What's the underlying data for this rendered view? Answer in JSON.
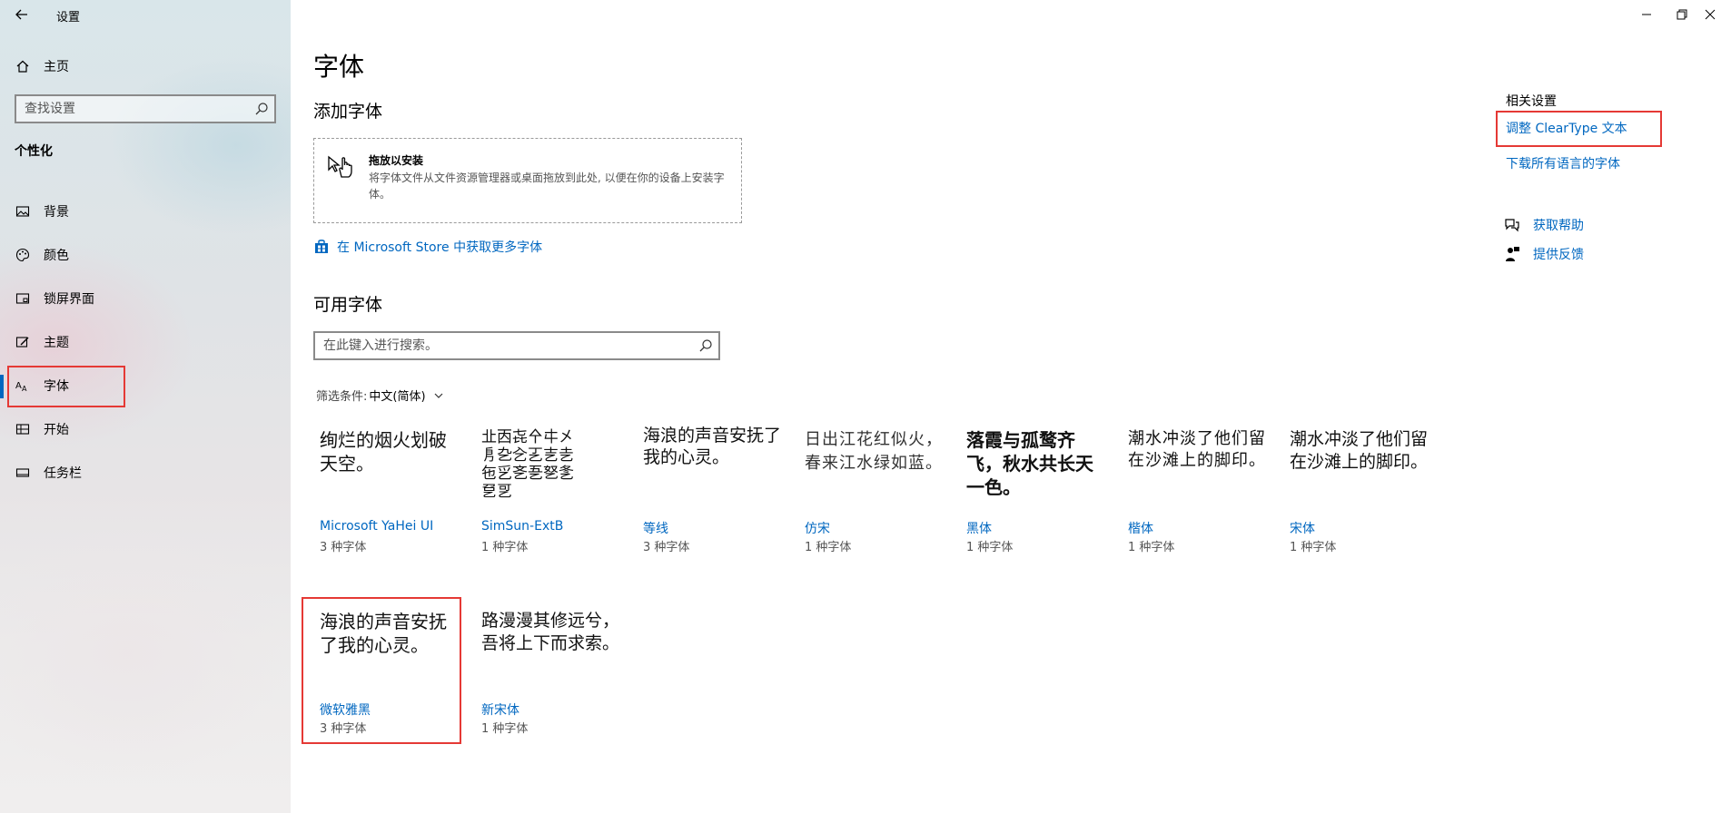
{
  "window": {
    "app_title": "设置",
    "controls": [
      "minimize-icon",
      "restore-icon",
      "close-icon"
    ]
  },
  "sidebar": {
    "home_label": "主页",
    "search_placeholder": "查找设置",
    "section_title": "个性化",
    "items": [
      {
        "label": "背景",
        "icon": "picture-icon"
      },
      {
        "label": "颜色",
        "icon": "palette-icon"
      },
      {
        "label": "锁屏界面",
        "icon": "lock-screen-icon"
      },
      {
        "label": "主题",
        "icon": "theme-brush-icon"
      },
      {
        "label": "字体",
        "icon": "font-aa-icon",
        "active": true
      },
      {
        "label": "开始",
        "icon": "start-tiles-icon"
      },
      {
        "label": "任务栏",
        "icon": "taskbar-icon"
      }
    ]
  },
  "main": {
    "page_title": "字体",
    "add_fonts_heading": "添加字体",
    "drop_zone": {
      "title": "拖放以安装",
      "description": "将字体文件从文件资源管理器或桌面拖放到此处, 以便在你的设备上安装字体。"
    },
    "store_link": "在 Microsoft Store 中获取更多字体",
    "available_heading": "可用字体",
    "font_search_placeholder": "在此键入进行搜索。",
    "filter_label": "筛选条件:",
    "filter_value": "中文(简体)",
    "fonts": [
      {
        "sample": "绚烂的烟火划破天空。",
        "name": "Microsoft YaHei UI",
        "count": "3 种字体"
      },
      {
        "sample": "㐀㐁㐂㐃㐄㐅㐆㐇㐈㐉㐊㐋㐌㐍㐎㐏㐐㐑㐒㐓",
        "name": "SimSun-ExtB",
        "count": "1 种字体"
      },
      {
        "sample": "海浪的声音安抚了我的心灵。",
        "name": "等线",
        "count": "3 种字体"
      },
      {
        "sample": "日出江花红似火，春来江水绿如蓝。",
        "name": "仿宋",
        "count": "1 种字体"
      },
      {
        "sample": "落霞与孤鹜齐飞，秋水共长天一色。",
        "name": "黑体",
        "count": "1 种字体"
      },
      {
        "sample": "潮水冲淡了他们留在沙滩上的脚印。",
        "name": "楷体",
        "count": "1 种字体"
      },
      {
        "sample": "潮水冲淡了他们留在沙滩上的脚印。",
        "name": "宋体",
        "count": "1 种字体"
      },
      {
        "sample": "海浪的声音安抚了我的心灵。",
        "name": "微软雅黑",
        "count": "3 种字体"
      },
      {
        "sample": "路漫漫其修远兮，吾将上下而求索。",
        "name": "新宋体",
        "count": "1 种字体"
      }
    ]
  },
  "related": {
    "title": "相关设置",
    "cleartype_link": "调整 ClearType 文本",
    "download_link": "下载所有语言的字体",
    "help_label": "获取帮助",
    "feedback_label": "提供反馈"
  },
  "colors": {
    "accent": "#0067c0",
    "highlight_box": "#e53935"
  }
}
